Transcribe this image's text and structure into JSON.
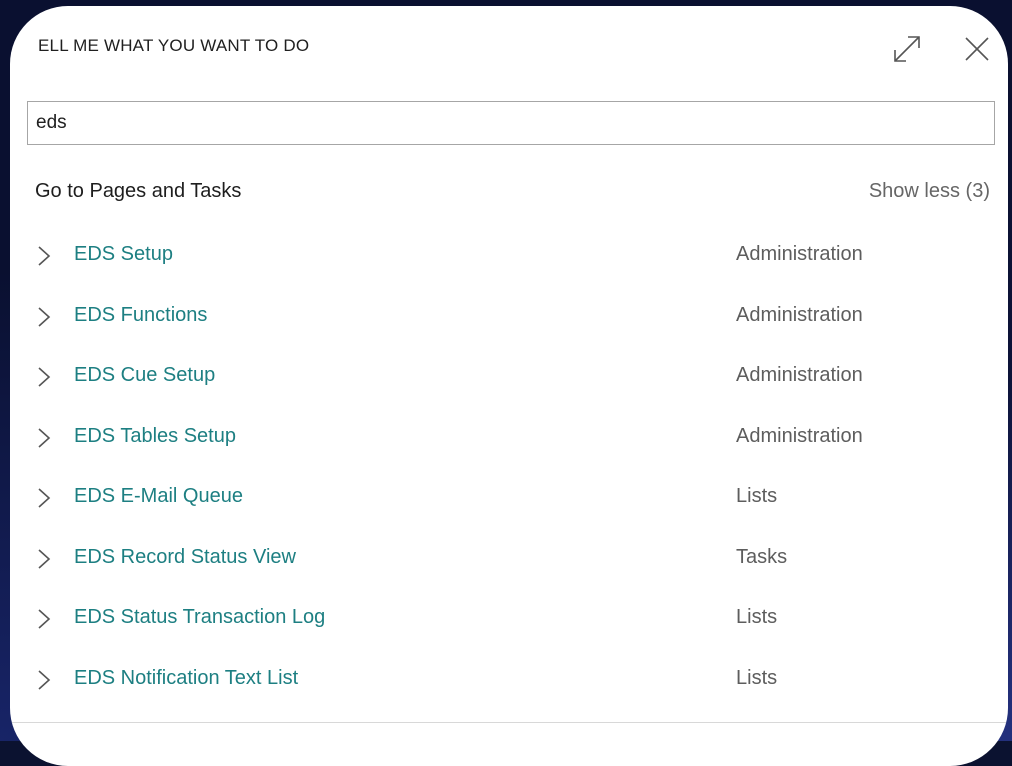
{
  "dialog": {
    "title": "ELL ME WHAT YOU WANT TO DO",
    "expand_icon": "expand-icon",
    "close_icon": "close-icon"
  },
  "search": {
    "value": "eds",
    "placeholder": ""
  },
  "section": {
    "title": "Go to Pages and Tasks",
    "toggle_label": "Show less (3)"
  },
  "results": [
    {
      "name": "EDS Setup",
      "category": "Administration"
    },
    {
      "name": "EDS Functions",
      "category": "Administration"
    },
    {
      "name": "EDS Cue Setup",
      "category": "Administration"
    },
    {
      "name": "EDS Tables Setup",
      "category": "Administration"
    },
    {
      "name": "EDS E-Mail Queue",
      "category": "Lists"
    },
    {
      "name": "EDS Record Status View",
      "category": "Tasks"
    },
    {
      "name": "EDS Status Transaction Log",
      "category": "Lists"
    },
    {
      "name": "EDS Notification Text List",
      "category": "Lists"
    }
  ],
  "colors": {
    "link": "#1d7f82",
    "category": "#5d5d5d",
    "background": "#0a1030"
  }
}
